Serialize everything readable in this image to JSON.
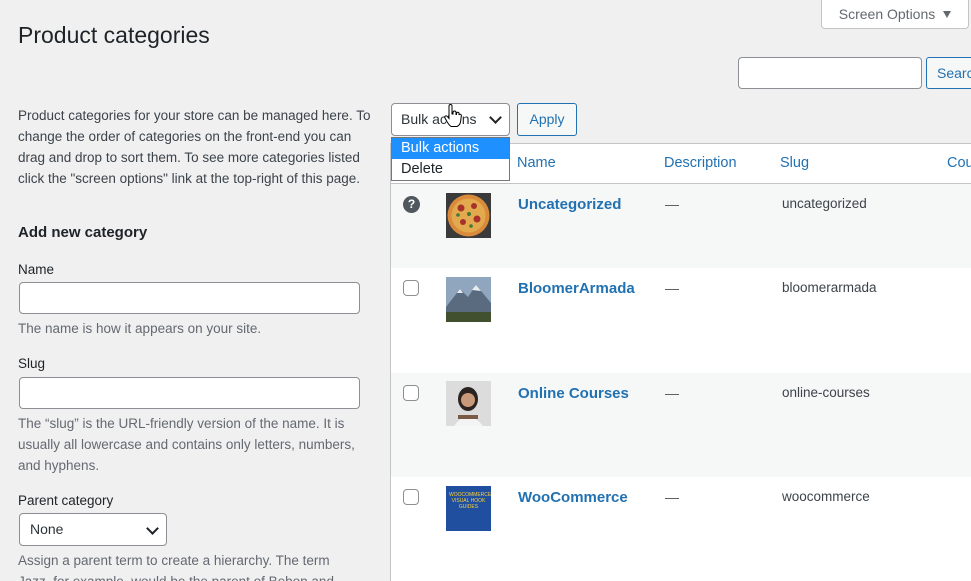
{
  "header": {
    "screen_options": "Screen Options",
    "title": "Product categories"
  },
  "search": {
    "value": "",
    "button": "Search"
  },
  "sidebar": {
    "intro": "Product categories for your store can be managed here. To change the order of categories on the front-end you can drag and drop to sort them. To see more categories listed click the \"screen options\" link at the top-right of this page.",
    "heading": "Add new category",
    "name_label": "Name",
    "name_value": "",
    "name_help": "The name is how it appears on your site.",
    "slug_label": "Slug",
    "slug_value": "",
    "slug_help": "The “slug” is the URL-friendly version of the name. It is usually all lowercase and contains only letters, numbers, and hyphens.",
    "parent_label": "Parent category",
    "parent_value": "None",
    "parent_help": "Assign a parent term to create a hierarchy. The term Jazz, for example, would be the parent of Bebop and"
  },
  "bulk": {
    "selected": "Bulk actions",
    "apply": "Apply",
    "options": [
      "Bulk actions",
      "Delete"
    ]
  },
  "table": {
    "headers": {
      "name": "Name",
      "description": "Description",
      "slug": "Slug",
      "count": "Count"
    },
    "rows": [
      {
        "name": "Uncategorized",
        "description": "—",
        "slug": "uncategorized",
        "selector": "help",
        "thumb": "pizza"
      },
      {
        "name": "BloomerArmada",
        "description": "—",
        "slug": "bloomerarmada",
        "selector": "checkbox",
        "thumb": "mountain"
      },
      {
        "name": "Online Courses",
        "description": "—",
        "slug": "online-courses",
        "selector": "checkbox",
        "thumb": "person"
      },
      {
        "name": "WooCommerce",
        "description": "—",
        "slug": "woocommerce",
        "selector": "checkbox",
        "thumb": "book",
        "thumb_text": "WOOCOMMERCE VISUAL HOOK GUIDES"
      }
    ]
  },
  "colors": {
    "link": "#2271b1",
    "dropdown_highlight": "#1e90ff",
    "background": "#f0f0f1"
  }
}
